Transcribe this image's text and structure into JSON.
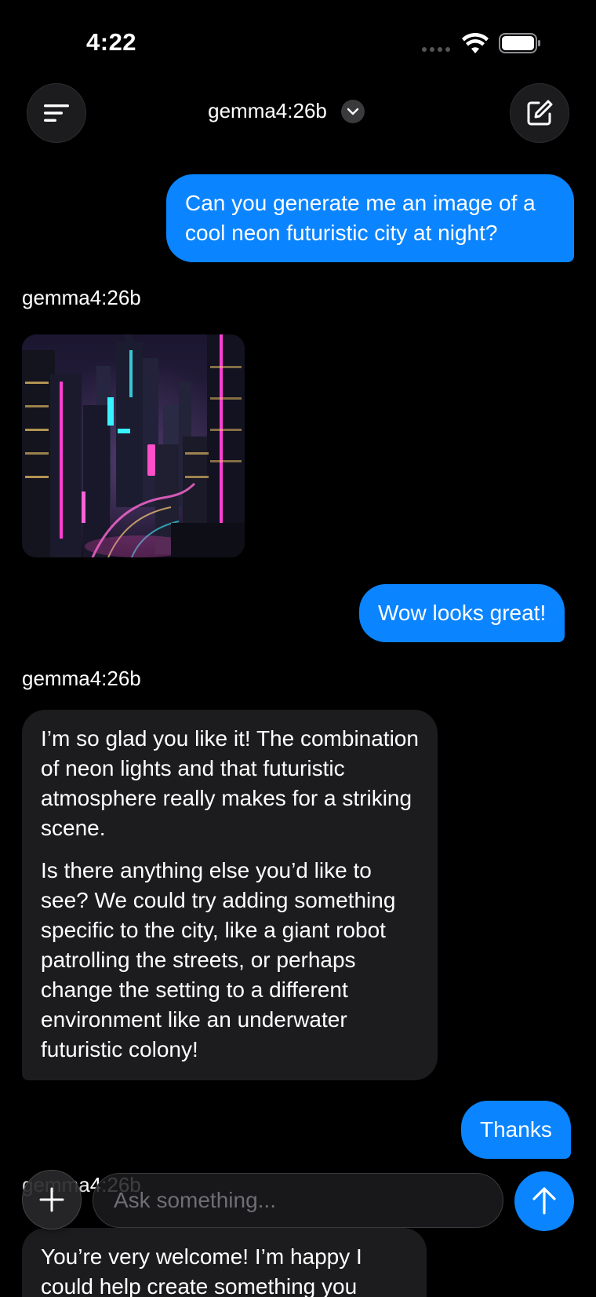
{
  "status_bar": {
    "time": "4:22",
    "icons": [
      "signal-dots-icon",
      "wifi-icon",
      "battery-icon"
    ]
  },
  "header": {
    "menu_icon": "hamburger-menu-icon",
    "model_name": "gemma4:26b",
    "model_chevron_icon": "chevron-down-icon",
    "compose_icon": "compose-icon"
  },
  "messages": [
    {
      "role": "user",
      "text": "Can you generate me an image of a cool neon futuristic city at night?"
    },
    {
      "role": "assistant",
      "label": "gemma4:26b",
      "content": "image",
      "image_alt": "neon futuristic city at night"
    },
    {
      "role": "user",
      "text": "Wow looks great!"
    },
    {
      "role": "assistant",
      "label": "gemma4:26b",
      "paragraphs": [
        "I’m so glad you like it! The combination of neon lights and that futuristic atmosphere really makes for a striking scene.",
        "Is there anything else you’d like to see? We could try adding something specific to the city, like a giant robot patrolling the streets, or perhaps change the setting to a different environment like an underwater futuristic colony!"
      ]
    },
    {
      "role": "user",
      "text": "Thanks"
    },
    {
      "role": "assistant",
      "label": "gemma4:26b",
      "text": "You’re very welcome! I’m happy I could help create something you"
    }
  ],
  "input_bar": {
    "plus_icon": "plus-icon",
    "placeholder": "Ask something...",
    "send_icon": "arrow-up-icon"
  },
  "colors": {
    "background": "#000000",
    "user_bubble": "#0a84ff",
    "assistant_bubble": "#1c1c1e",
    "send_button": "#0a84ff"
  }
}
